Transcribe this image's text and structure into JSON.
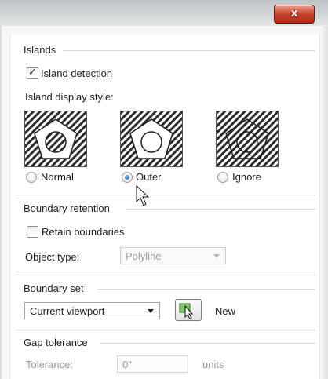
{
  "window": {
    "close_glyph": "x"
  },
  "islands": {
    "header": "Islands",
    "island_detection": {
      "label": "Island detection",
      "checked": true
    },
    "display_style_label": "Island display style:",
    "styles": [
      {
        "label": "Normal",
        "selected": false,
        "icon": "island-normal-preview"
      },
      {
        "label": "Outer",
        "selected": true,
        "icon": "island-outer-preview"
      },
      {
        "label": "Ignore",
        "selected": false,
        "icon": "island-ignore-preview"
      }
    ]
  },
  "boundary_retention": {
    "header": "Boundary retention",
    "retain": {
      "label": "Retain boundaries",
      "checked": false
    },
    "object_type_label": "Object type:",
    "object_type_value": "Polyline"
  },
  "boundary_set": {
    "header": "Boundary set",
    "selected": "Current viewport",
    "new_label": "New",
    "new_icon": "select-objects-icon"
  },
  "gap_tolerance": {
    "header": "Gap tolerance",
    "tolerance_label": "Tolerance:",
    "tolerance_value": "0\"",
    "units_label": "units"
  },
  "colors": {
    "close_button": "#c8412b",
    "radio_selected": "#1f5fa8"
  }
}
